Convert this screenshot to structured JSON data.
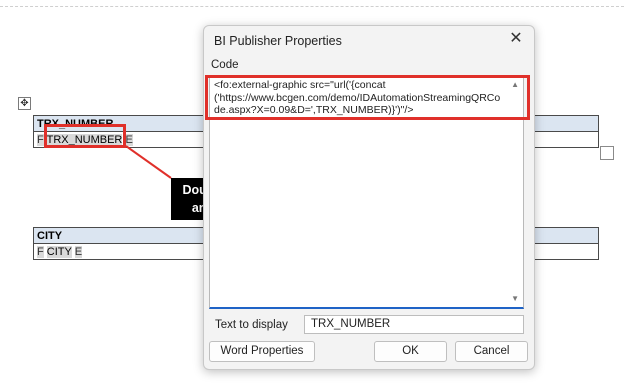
{
  "document": {
    "table1": {
      "header": "TRX_NUMBER",
      "field_start": "F",
      "field_name": "TRX_NUMBER",
      "field_end": "E"
    },
    "table2": {
      "header": "CITY",
      "field_start": "F",
      "field_name": "CITY",
      "field_end": "E"
    },
    "move_handle_icon": "move-icon"
  },
  "callout": {
    "line1": "Double click the field",
    "line2": "and add the code.",
    "color": "#e0302a"
  },
  "dialog": {
    "title": "BI Publisher Properties",
    "close_icon": "close-icon",
    "code_label": "Code",
    "code_value": "<fo:external-graphic src=\"url('{concat ('https://www.bcgen.com/demo/IDAutomationStreamingQRCode.aspx?X=0.09&D=',TRX_NUMBER)}')\"/>",
    "text_to_display_label": "Text to display",
    "text_to_display_value": "TRX_NUMBER",
    "word_properties_button": "Word Properties",
    "ok_button": "OK",
    "cancel_button": "Cancel"
  }
}
